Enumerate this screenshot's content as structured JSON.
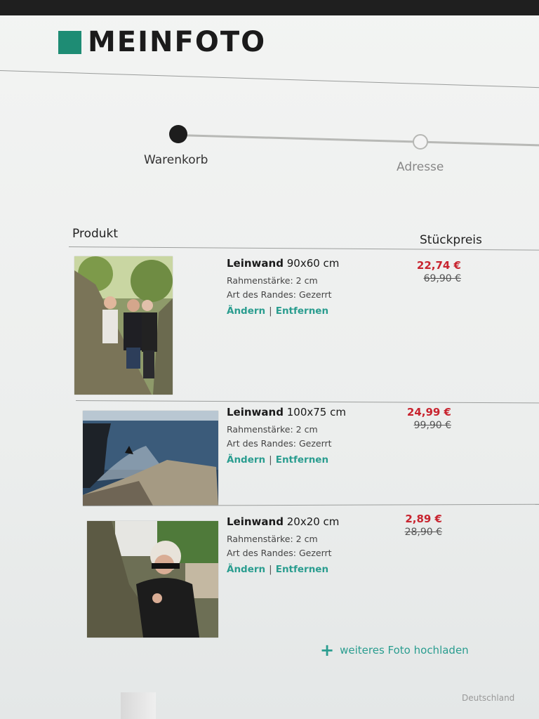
{
  "banner": {
    "text": ""
  },
  "brand": {
    "name": "MEINFOTO",
    "color": "#1e8c74"
  },
  "checkout_steps": [
    {
      "label": "Warenkorb",
      "state": "active"
    },
    {
      "label": "Adresse",
      "state": "pending"
    }
  ],
  "table": {
    "col_product": "Produkt",
    "col_unit_price": "Stückpreis"
  },
  "items": [
    {
      "product": "Leinwand",
      "size": "90x60 cm",
      "frame": "Rahmenstärke: 2 cm",
      "edge": "Art des Randes: Gezerrt",
      "edit": "Ändern",
      "remove": "Entfernen",
      "price": "22,74 €",
      "old_price": "69,90 €",
      "thumb": "photo-three-people-at-tree"
    },
    {
      "product": "Leinwand",
      "size": "100x75 cm",
      "frame": "Rahmenstärke: 2 cm",
      "edge": "Art des Randes: Gezerrt",
      "edit": "Ändern",
      "remove": "Entfernen",
      "price": "24,99 €",
      "old_price": "99,90 €",
      "thumb": "photo-sea-cliff"
    },
    {
      "product": "Leinwand",
      "size": "20x20 cm",
      "frame": "Rahmenstärke: 2 cm",
      "edge": "Art des Randes: Gezerrt",
      "edit": "Ändern",
      "remove": "Entfernen",
      "price": "2,89 €",
      "old_price": "28,90 €",
      "thumb": "photo-woman-behind-tree"
    }
  ],
  "upload": {
    "icon": "plus-icon",
    "label": "weiteres Foto hochladen"
  },
  "recommendation": {
    "label": "",
    "name": "",
    "price": ""
  },
  "summary": {
    "subtotal_label": "",
    "shipping_label": "",
    "shipping_country": "Deutschland"
  },
  "colors": {
    "accent": "#2a9d8f",
    "price": "#c8242f",
    "text": "#222222"
  }
}
